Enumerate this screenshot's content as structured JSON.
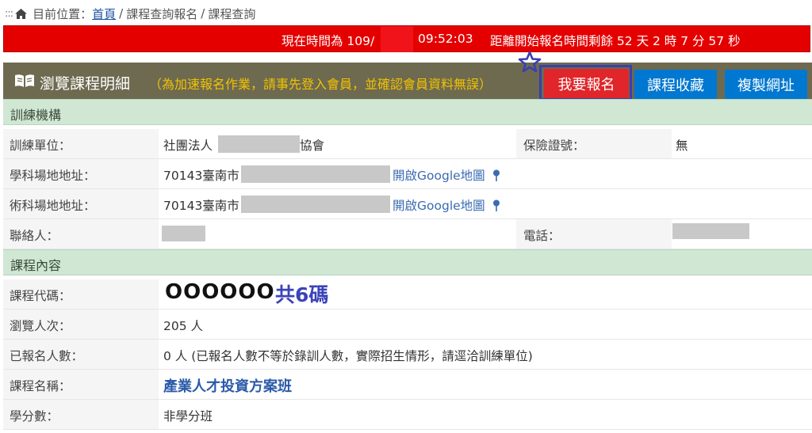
{
  "breadcrumb": {
    "dots": ":::",
    "prefix": "目前位置：",
    "home_link": "首頁",
    "sep": "/",
    "item1": "課程查詢報名",
    "item2": "課程查詢"
  },
  "timebar": {
    "current_prefix": "現在時間為 109/",
    "current_time": "09:52:03",
    "countdown": "距離開始報名時間剩餘 52 天 2 時 7 分 57 秒"
  },
  "panel": {
    "title": "瀏覽課程明細",
    "note": "（為加速報名作業，請事先登入會員，並確認會員資料無誤）",
    "buttons": {
      "register": "我要報名",
      "favorite": "課程收藏",
      "copy_url": "複製網址"
    }
  },
  "sections": {
    "org": "訓練機構",
    "content": "課程內容"
  },
  "org_rows": {
    "unit_label": "訓練單位：",
    "unit_prefix": "社團法人",
    "unit_suffix": "協會",
    "insurance_label": "保險證號：",
    "insurance_value": "無",
    "academic_label": "學科場地地址：",
    "academic_prefix": "70143臺南市",
    "academic_map": "開啟Google地圖",
    "practical_label": "術科場地地址：",
    "practical_prefix": "70143臺南市",
    "practical_map": "開啟Google地圖",
    "contact_label": "聯絡人：",
    "phone_label": "電話："
  },
  "content_rows": {
    "code_label": "課程代碼：",
    "code_value": "OOOOOO",
    "code_note": "共6碼",
    "views_label": "瀏覽人次：",
    "views_value": "205 人",
    "enrolled_label": "已報名人數：",
    "enrolled_value": "0 人 (已報名人數不等於錄訓人數，實際招生情形，請逕洽訓練單位)",
    "name_label": "課程名稱：",
    "name_value": "產業人才投資方案班",
    "credit_label": "學分數：",
    "credit_value": "非學分班"
  },
  "colors": {
    "timebar": "#e50000",
    "panel_header": "#6d6a50",
    "note_text": "#f2c200",
    "register_button": "#e0262a",
    "blue_button": "#0077d0",
    "section_header": "#cfe7d3",
    "highlight": "#3a3fb0"
  }
}
